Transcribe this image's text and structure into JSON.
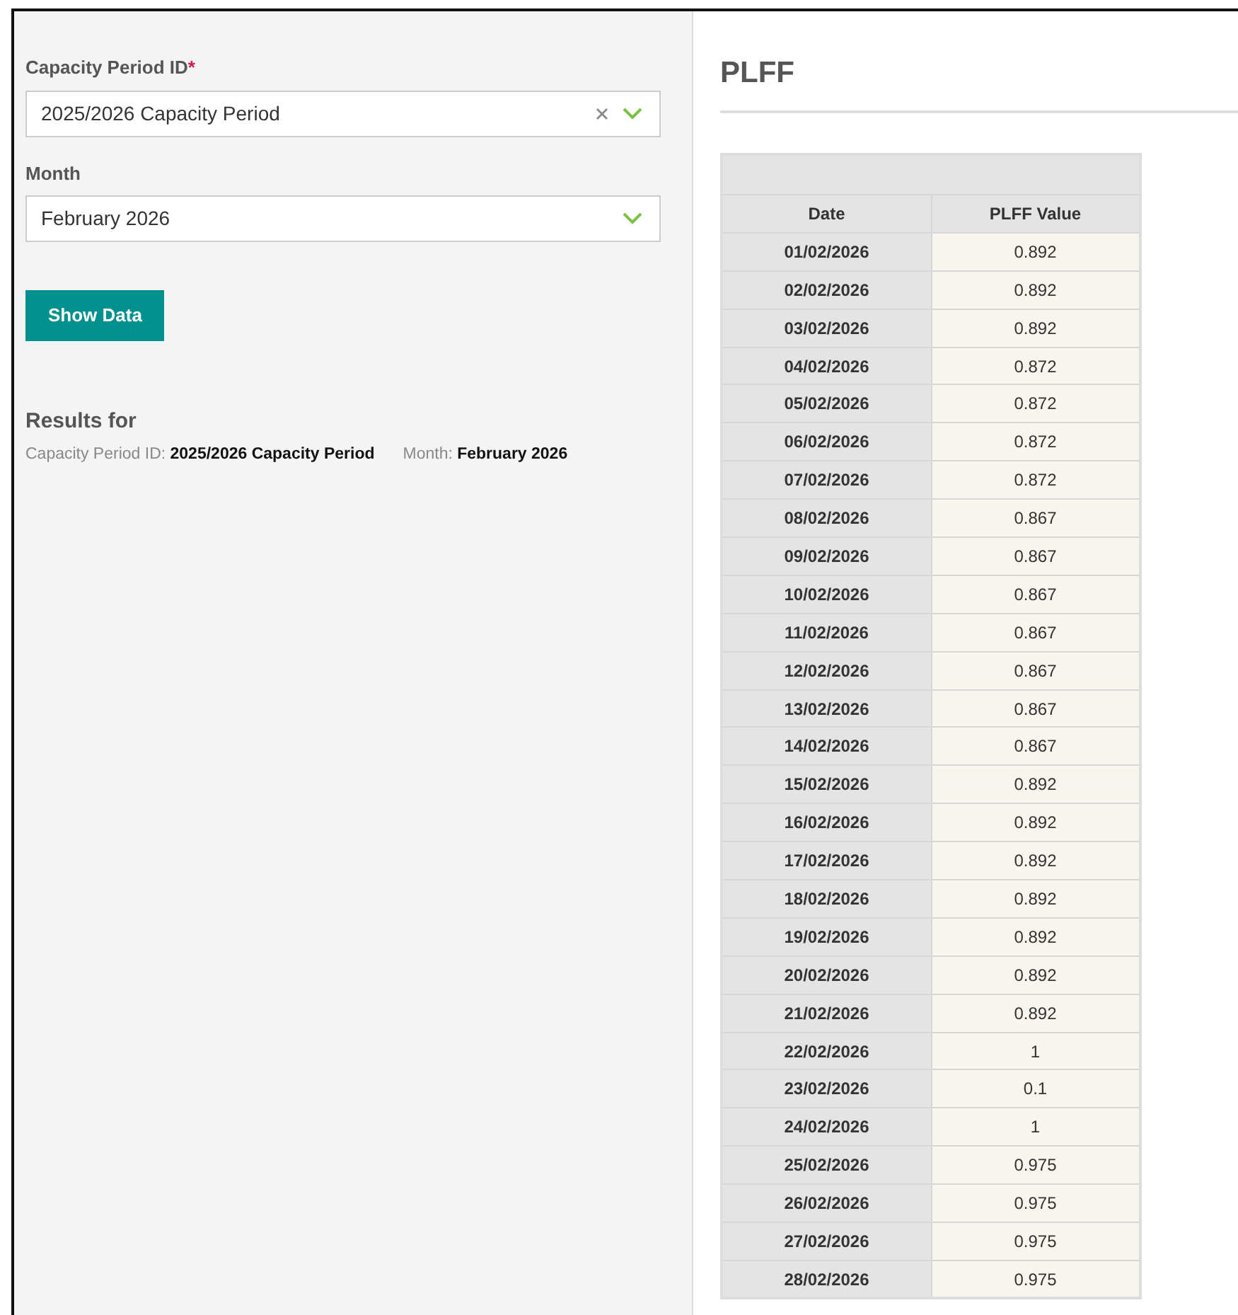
{
  "filters": [
    {
      "label": "Capacity Period ID",
      "required_mark": "*",
      "value": "2025/2026 Capacity Period",
      "clearable": true
    },
    {
      "label": "Month",
      "value": "February 2026",
      "clearable": false
    }
  ],
  "button": "Show Data",
  "results": {
    "title": "Results for",
    "items": [
      {
        "label": "Capacity Period ID:",
        "value": "2025/2026 Capacity Period"
      },
      {
        "label": "Month:",
        "value": "February 2026"
      }
    ]
  },
  "panel": {
    "title": "PLFF",
    "table": {
      "columns": [
        "Date",
        "PLFF Value"
      ],
      "rows": [
        [
          "01/02/2026",
          "0.892"
        ],
        [
          "02/02/2026",
          "0.892"
        ],
        [
          "03/02/2026",
          "0.892"
        ],
        [
          "04/02/2026",
          "0.872"
        ],
        [
          "05/02/2026",
          "0.872"
        ],
        [
          "06/02/2026",
          "0.872"
        ],
        [
          "07/02/2026",
          "0.872"
        ],
        [
          "08/02/2026",
          "0.867"
        ],
        [
          "09/02/2026",
          "0.867"
        ],
        [
          "10/02/2026",
          "0.867"
        ],
        [
          "11/02/2026",
          "0.867"
        ],
        [
          "12/02/2026",
          "0.867"
        ],
        [
          "13/02/2026",
          "0.867"
        ],
        [
          "14/02/2026",
          "0.867"
        ],
        [
          "15/02/2026",
          "0.892"
        ],
        [
          "16/02/2026",
          "0.892"
        ],
        [
          "17/02/2026",
          "0.892"
        ],
        [
          "18/02/2026",
          "0.892"
        ],
        [
          "19/02/2026",
          "0.892"
        ],
        [
          "20/02/2026",
          "0.892"
        ],
        [
          "21/02/2026",
          "0.892"
        ],
        [
          "22/02/2026",
          "1"
        ],
        [
          "23/02/2026",
          "0.1"
        ],
        [
          "24/02/2026",
          "1"
        ],
        [
          "25/02/2026",
          "0.975"
        ],
        [
          "26/02/2026",
          "0.975"
        ],
        [
          "27/02/2026",
          "0.975"
        ],
        [
          "28/02/2026",
          "0.975"
        ]
      ]
    }
  }
}
